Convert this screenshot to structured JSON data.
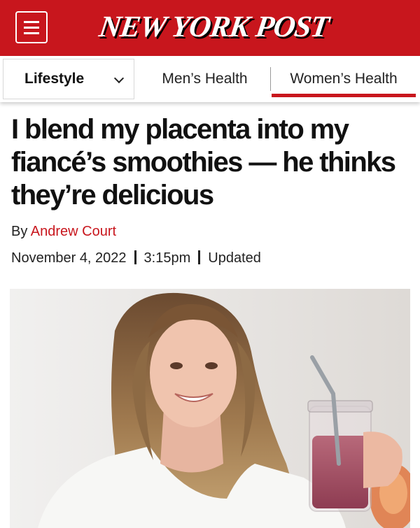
{
  "header": {
    "menu_icon": "hamburger-menu-icon",
    "logo_text": "NEW YORK POST",
    "brand_color": "#c8161d"
  },
  "subnav": {
    "section": "Lifestyle",
    "section_icon": "chevron-down-icon",
    "tabs": [
      {
        "label": "Men’s Health",
        "active": false
      },
      {
        "label": "Women’s Health",
        "active": true
      }
    ]
  },
  "article": {
    "headline": "I blend my placenta into my fiancé’s smoothies — he thinks they’re delicious",
    "by_prefix": "By",
    "author": "Andrew Court",
    "date": "November 4, 2022",
    "time": "3:15pm",
    "updated": "Updated"
  },
  "image": {
    "subject": "woman holding a mason jar of pink smoothie with a metal straw"
  }
}
